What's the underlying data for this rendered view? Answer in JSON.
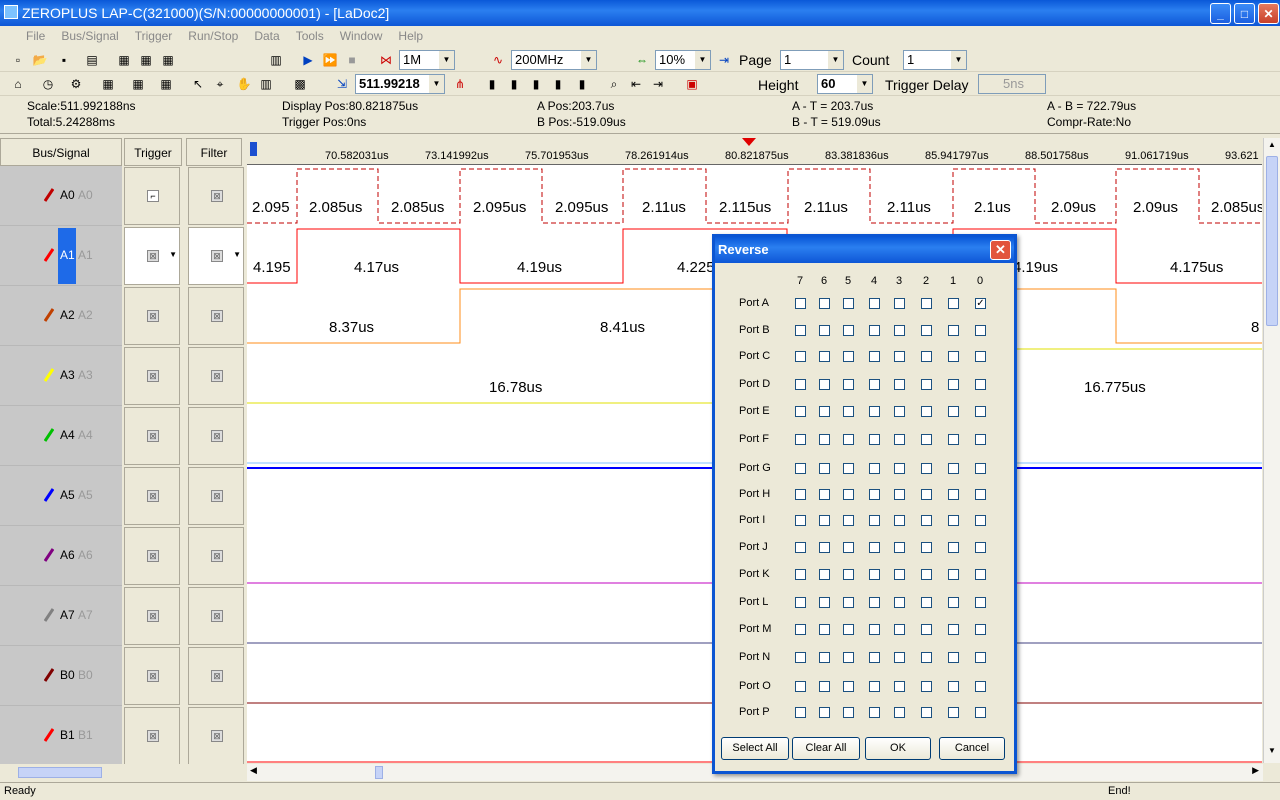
{
  "window": {
    "title": "ZEROPLUS LAP-C(321000)(S/N:00000000001) - [LaDoc2]"
  },
  "menu": [
    "File",
    "Bus/Signal",
    "Trigger",
    "Run/Stop",
    "Data",
    "Tools",
    "Window",
    "Help"
  ],
  "toolbar": {
    "depth": "1M",
    "freq": "200MHz",
    "zoom": "10%",
    "page_label": "Page",
    "page": "1",
    "count_label": "Count",
    "count": "1",
    "scale": "511.99218",
    "height_label": "Height",
    "height": "60",
    "trigger_delay_label": "Trigger Delay",
    "trigger_delay": "5ns"
  },
  "info": {
    "scale": "Scale:511.992188ns",
    "total": "Total:5.24288ms",
    "display_pos": "Display Pos:80.821875us",
    "trigger_pos": "Trigger Pos:0ns",
    "a_pos": "A Pos:203.7us",
    "b_pos": "B Pos:-519.09us",
    "a_t": "A - T = 203.7us",
    "b_t": "B - T = 519.09us",
    "a_b": "A - B = 722.79us",
    "compr": "Compr-Rate:No"
  },
  "panel": {
    "bus_signal": "Bus/Signal",
    "trigger": "Trigger",
    "filter": "Filter"
  },
  "signals": [
    {
      "name": "A0",
      "alias": "A0",
      "color": "#c00000"
    },
    {
      "name": "A1",
      "alias": "A1",
      "color": "#ff0000"
    },
    {
      "name": "A2",
      "alias": "A2",
      "color": "#c04000"
    },
    {
      "name": "A3",
      "alias": "A3",
      "color": "#ffff00"
    },
    {
      "name": "A4",
      "alias": "A4",
      "color": "#00c000"
    },
    {
      "name": "A5",
      "alias": "A5",
      "color": "#0000ff"
    },
    {
      "name": "A6",
      "alias": "A6",
      "color": "#800080"
    },
    {
      "name": "A7",
      "alias": "A7",
      "color": "#808080"
    },
    {
      "name": "B0",
      "alias": "B0",
      "color": "#800000"
    },
    {
      "name": "B1",
      "alias": "B1",
      "color": "#ff0000"
    }
  ],
  "ruler": [
    "70.582031us",
    "73.141992us",
    "75.701953us",
    "78.261914us",
    "80.821875us",
    "83.381836us",
    "85.941797us",
    "88.501758us",
    "91.061719us",
    "93.621"
  ],
  "wave_labels": {
    "a0": [
      "2.095",
      "2.085us",
      "2.085us",
      "2.095us",
      "2.095us",
      "2.11us",
      "2.115us",
      "2.11us",
      "2.11us",
      "2.1us",
      "2.09us",
      "2.09us",
      "2.085us"
    ],
    "a1": [
      "4.195",
      "4.17us",
      "4.19us",
      "4.225",
      "4.19us",
      "4.175us"
    ],
    "a2": [
      "8.37us",
      "8.41us",
      "8"
    ],
    "a3": [
      "16.78us",
      "16.775us"
    ]
  },
  "dialog": {
    "title": "Reverse",
    "bits": [
      "7",
      "6",
      "5",
      "4",
      "3",
      "2",
      "1",
      "0"
    ],
    "ports": [
      "Port A",
      "Port B",
      "Port C",
      "Port D",
      "Port E",
      "Port F",
      "Port G",
      "Port H",
      "Port I",
      "Port J",
      "Port K",
      "Port L",
      "Port M",
      "Port N",
      "Port O",
      "Port P"
    ],
    "checked": "Port A bit 0",
    "select_all": "Select All",
    "clear_all": "Clear All",
    "ok": "OK",
    "cancel": "Cancel"
  },
  "status": {
    "left": "Ready",
    "right": "End!"
  }
}
